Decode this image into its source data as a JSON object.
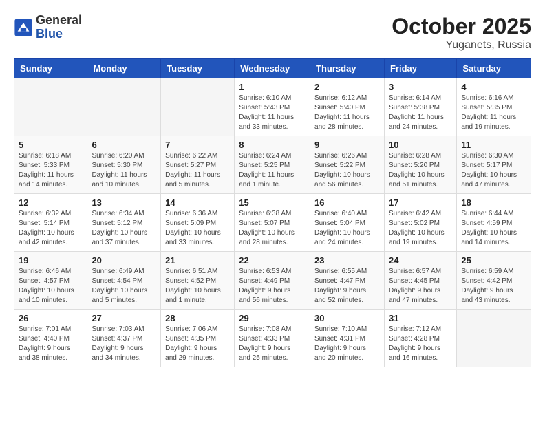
{
  "header": {
    "logo": {
      "general": "General",
      "blue": "Blue"
    },
    "title": "October 2025",
    "subtitle": "Yuganets, Russia"
  },
  "calendar": {
    "weekdays": [
      "Sunday",
      "Monday",
      "Tuesday",
      "Wednesday",
      "Thursday",
      "Friday",
      "Saturday"
    ],
    "weeks": [
      [
        {
          "day": "",
          "info": ""
        },
        {
          "day": "",
          "info": ""
        },
        {
          "day": "",
          "info": ""
        },
        {
          "day": "1",
          "info": "Sunrise: 6:10 AM\nSunset: 5:43 PM\nDaylight: 11 hours\nand 33 minutes."
        },
        {
          "day": "2",
          "info": "Sunrise: 6:12 AM\nSunset: 5:40 PM\nDaylight: 11 hours\nand 28 minutes."
        },
        {
          "day": "3",
          "info": "Sunrise: 6:14 AM\nSunset: 5:38 PM\nDaylight: 11 hours\nand 24 minutes."
        },
        {
          "day": "4",
          "info": "Sunrise: 6:16 AM\nSunset: 5:35 PM\nDaylight: 11 hours\nand 19 minutes."
        }
      ],
      [
        {
          "day": "5",
          "info": "Sunrise: 6:18 AM\nSunset: 5:33 PM\nDaylight: 11 hours\nand 14 minutes."
        },
        {
          "day": "6",
          "info": "Sunrise: 6:20 AM\nSunset: 5:30 PM\nDaylight: 11 hours\nand 10 minutes."
        },
        {
          "day": "7",
          "info": "Sunrise: 6:22 AM\nSunset: 5:27 PM\nDaylight: 11 hours\nand 5 minutes."
        },
        {
          "day": "8",
          "info": "Sunrise: 6:24 AM\nSunset: 5:25 PM\nDaylight: 11 hours\nand 1 minute."
        },
        {
          "day": "9",
          "info": "Sunrise: 6:26 AM\nSunset: 5:22 PM\nDaylight: 10 hours\nand 56 minutes."
        },
        {
          "day": "10",
          "info": "Sunrise: 6:28 AM\nSunset: 5:20 PM\nDaylight: 10 hours\nand 51 minutes."
        },
        {
          "day": "11",
          "info": "Sunrise: 6:30 AM\nSunset: 5:17 PM\nDaylight: 10 hours\nand 47 minutes."
        }
      ],
      [
        {
          "day": "12",
          "info": "Sunrise: 6:32 AM\nSunset: 5:14 PM\nDaylight: 10 hours\nand 42 minutes."
        },
        {
          "day": "13",
          "info": "Sunrise: 6:34 AM\nSunset: 5:12 PM\nDaylight: 10 hours\nand 37 minutes."
        },
        {
          "day": "14",
          "info": "Sunrise: 6:36 AM\nSunset: 5:09 PM\nDaylight: 10 hours\nand 33 minutes."
        },
        {
          "day": "15",
          "info": "Sunrise: 6:38 AM\nSunset: 5:07 PM\nDaylight: 10 hours\nand 28 minutes."
        },
        {
          "day": "16",
          "info": "Sunrise: 6:40 AM\nSunset: 5:04 PM\nDaylight: 10 hours\nand 24 minutes."
        },
        {
          "day": "17",
          "info": "Sunrise: 6:42 AM\nSunset: 5:02 PM\nDaylight: 10 hours\nand 19 minutes."
        },
        {
          "day": "18",
          "info": "Sunrise: 6:44 AM\nSunset: 4:59 PM\nDaylight: 10 hours\nand 14 minutes."
        }
      ],
      [
        {
          "day": "19",
          "info": "Sunrise: 6:46 AM\nSunset: 4:57 PM\nDaylight: 10 hours\nand 10 minutes."
        },
        {
          "day": "20",
          "info": "Sunrise: 6:49 AM\nSunset: 4:54 PM\nDaylight: 10 hours\nand 5 minutes."
        },
        {
          "day": "21",
          "info": "Sunrise: 6:51 AM\nSunset: 4:52 PM\nDaylight: 10 hours\nand 1 minute."
        },
        {
          "day": "22",
          "info": "Sunrise: 6:53 AM\nSunset: 4:49 PM\nDaylight: 9 hours\nand 56 minutes."
        },
        {
          "day": "23",
          "info": "Sunrise: 6:55 AM\nSunset: 4:47 PM\nDaylight: 9 hours\nand 52 minutes."
        },
        {
          "day": "24",
          "info": "Sunrise: 6:57 AM\nSunset: 4:45 PM\nDaylight: 9 hours\nand 47 minutes."
        },
        {
          "day": "25",
          "info": "Sunrise: 6:59 AM\nSunset: 4:42 PM\nDaylight: 9 hours\nand 43 minutes."
        }
      ],
      [
        {
          "day": "26",
          "info": "Sunrise: 7:01 AM\nSunset: 4:40 PM\nDaylight: 9 hours\nand 38 minutes."
        },
        {
          "day": "27",
          "info": "Sunrise: 7:03 AM\nSunset: 4:37 PM\nDaylight: 9 hours\nand 34 minutes."
        },
        {
          "day": "28",
          "info": "Sunrise: 7:06 AM\nSunset: 4:35 PM\nDaylight: 9 hours\nand 29 minutes."
        },
        {
          "day": "29",
          "info": "Sunrise: 7:08 AM\nSunset: 4:33 PM\nDaylight: 9 hours\nand 25 minutes."
        },
        {
          "day": "30",
          "info": "Sunrise: 7:10 AM\nSunset: 4:31 PM\nDaylight: 9 hours\nand 20 minutes."
        },
        {
          "day": "31",
          "info": "Sunrise: 7:12 AM\nSunset: 4:28 PM\nDaylight: 9 hours\nand 16 minutes."
        },
        {
          "day": "",
          "info": ""
        }
      ]
    ]
  }
}
